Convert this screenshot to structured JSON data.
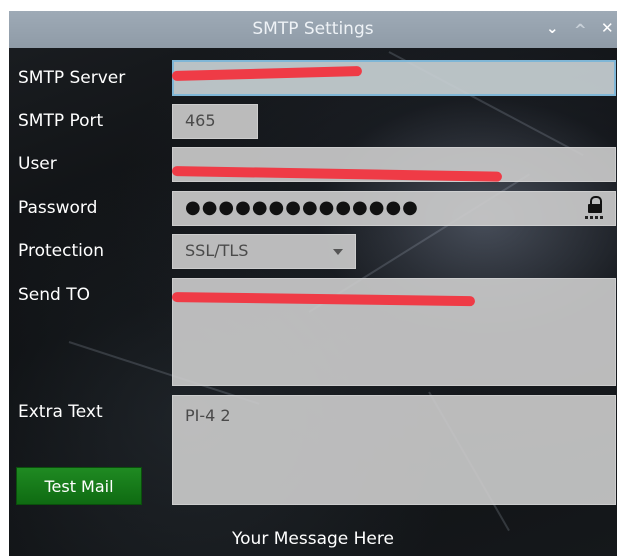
{
  "window": {
    "title": "SMTP Settings",
    "controls": {
      "minimize": "⌄",
      "maximize": "^",
      "close": "✕"
    }
  },
  "labels": {
    "server": "SMTP Server",
    "port": "SMTP Port",
    "user": "User",
    "password": "Password",
    "protection": "Protection",
    "send_to": "Send TO",
    "extra_text": "Extra Text"
  },
  "fields": {
    "port": "465",
    "password_mask": "●●●●●●●●●●●●●●",
    "protection": "SSL/TLS",
    "extra_text": "PI-4 2"
  },
  "buttons": {
    "test_mail": "Test Mail"
  },
  "status": {
    "message": "Your Message Here"
  },
  "colors": {
    "redaction": "#ef3b46",
    "test_button": "#1f8a22",
    "titlebar": "#9eaab6"
  }
}
